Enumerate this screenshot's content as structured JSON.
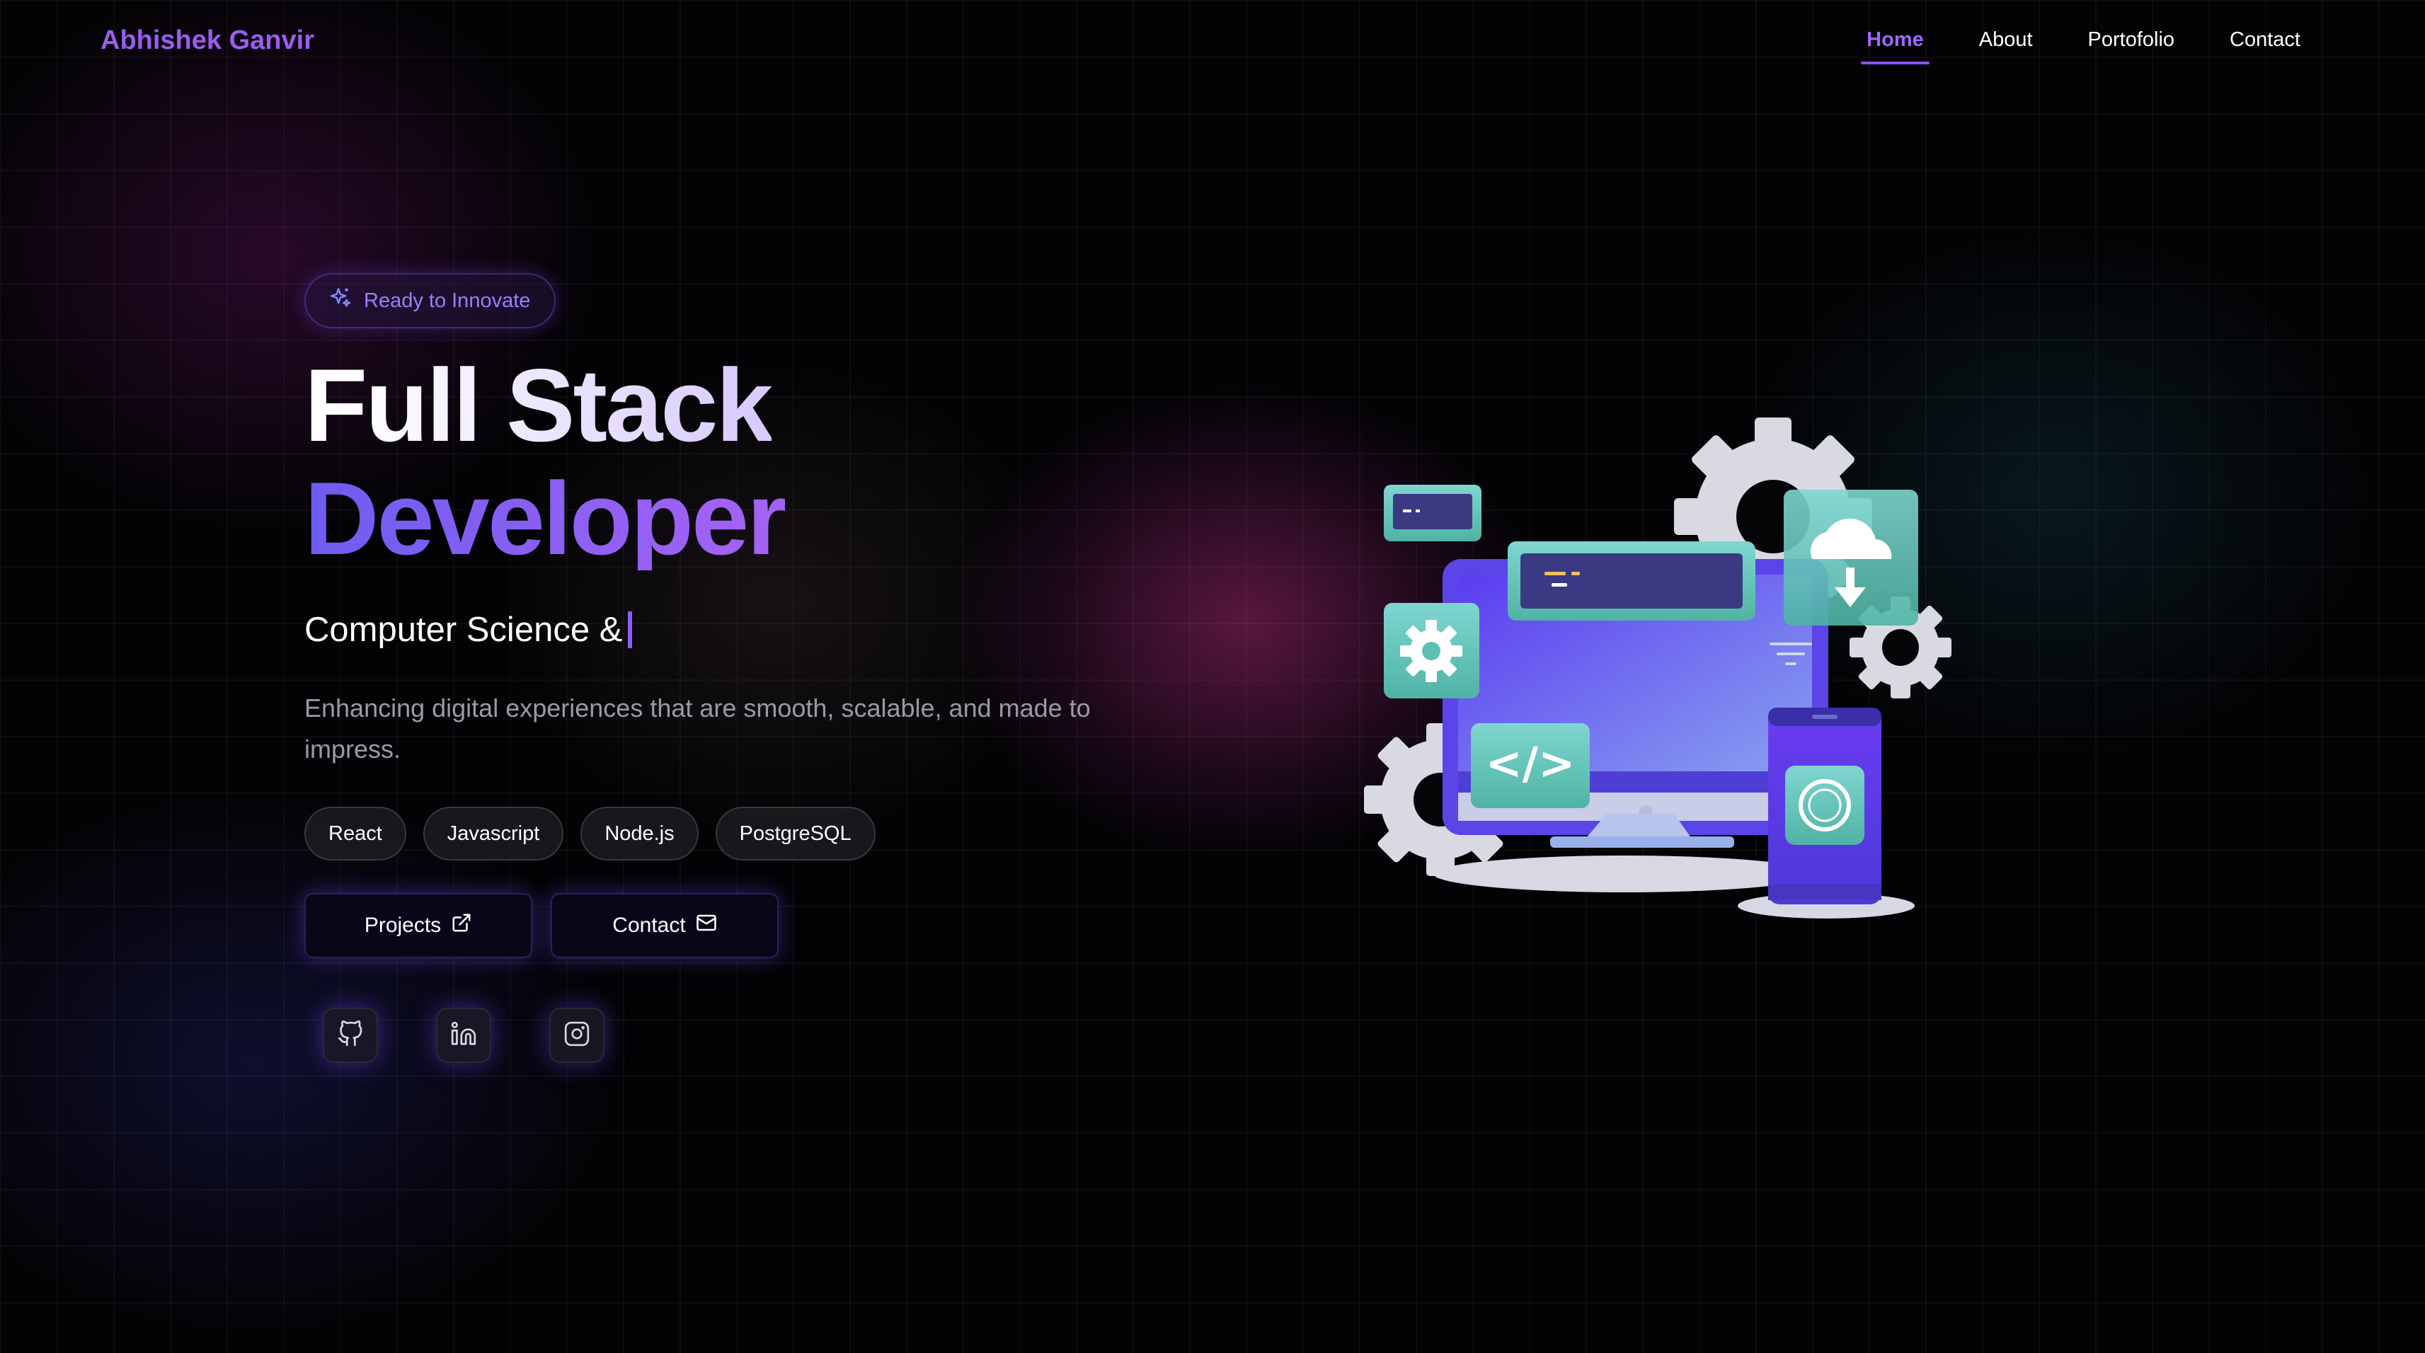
{
  "brand": "Abhishek Ganvir",
  "nav": {
    "home": "Home",
    "about": "About",
    "portfolio": "Portofolio",
    "contact": "Contact"
  },
  "hero": {
    "badge": "Ready to Innovate",
    "title_line1": "Full Stack",
    "title_line2": "Developer",
    "subtitle": "Computer Science &",
    "description": "Enhancing digital experiences that are smooth, scalable, and made to impress.",
    "tags": [
      "React",
      "Javascript",
      "Node.js",
      "PostgreSQL"
    ],
    "buttons": {
      "projects": "Projects",
      "contact": "Contact"
    }
  },
  "socials": [
    "github-icon",
    "linkedin-icon",
    "instagram-icon"
  ],
  "colors": {
    "accent": "#9b5cf0",
    "background": "#030305"
  }
}
